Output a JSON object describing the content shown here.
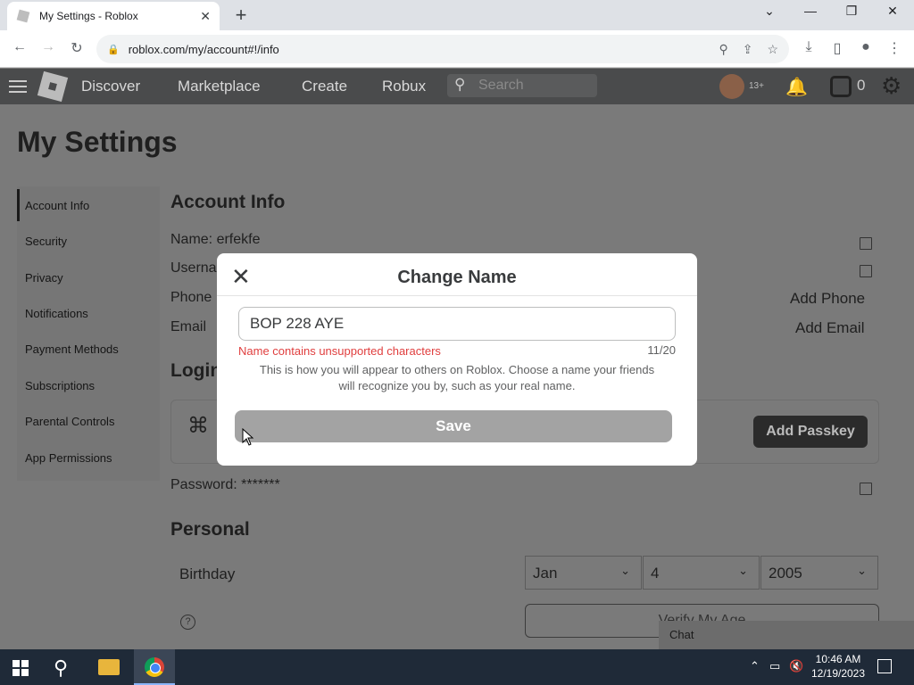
{
  "browser": {
    "tab_title": "My Settings - Roblox",
    "url": "roblox.com/my/account#!/info"
  },
  "nav": {
    "links": [
      "Discover",
      "Marketplace",
      "Create",
      "Robux"
    ],
    "search_placeholder": "Search",
    "age_badge": "13+",
    "robux_count": "0"
  },
  "page": {
    "title": "My Settings",
    "sidebar": [
      "Account Info",
      "Security",
      "Privacy",
      "Notifications",
      "Payment Methods",
      "Subscriptions",
      "Parental Controls",
      "App Permissions"
    ],
    "account_info_title": "Account Info",
    "name_label": "Name:",
    "name_value": "erfekfe",
    "username_label": "Userna",
    "phone_label": "Phone",
    "email_label": "Email",
    "add_phone": "Add Phone",
    "add_email": "Add Email",
    "login_title": "Login",
    "add_passkey": "Add Passkey",
    "password_label": "Password:",
    "password_value": "*******",
    "personal_title": "Personal",
    "birthday_label": "Birthday",
    "birthday_month": "Jan",
    "birthday_day": "4",
    "birthday_year": "2005",
    "verify_age": "Verify My Age",
    "chat_label": "Chat"
  },
  "modal": {
    "title": "Change Name",
    "input_value": "BOP 228 AYE",
    "error": "Name contains unsupported characters",
    "counter": "11/20",
    "help": "This is how you will appear to others on Roblox. Choose a name your friends will recognize you by, such as your real name.",
    "save_label": "Save"
  },
  "taskbar": {
    "time": "10:46 AM",
    "date": "12/19/2023"
  }
}
